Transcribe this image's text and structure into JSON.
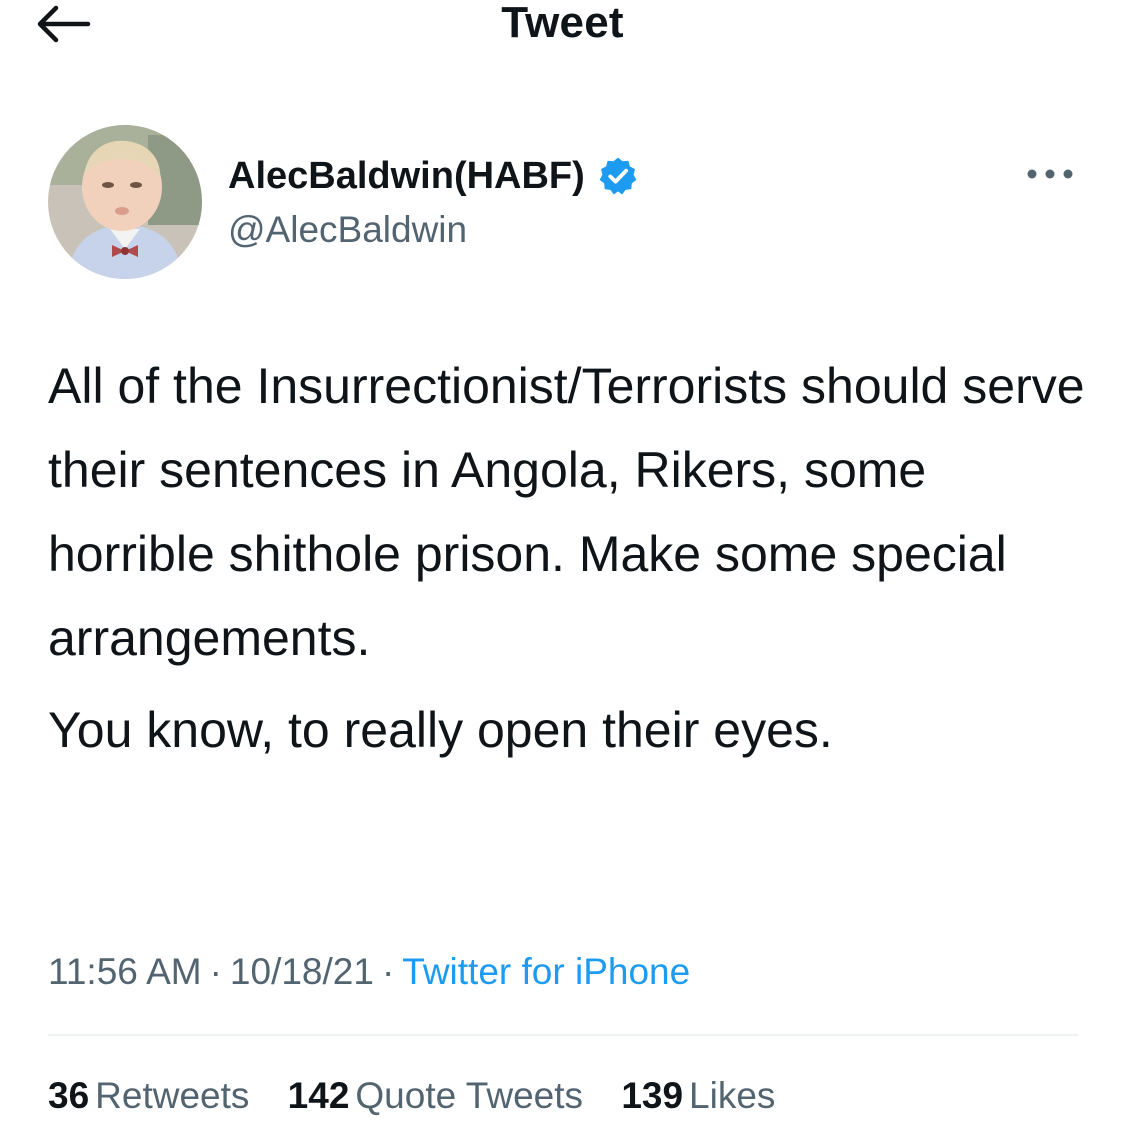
{
  "header": {
    "title": "Tweet",
    "back_icon": "arrow-left-icon"
  },
  "author": {
    "display_name": "AlecBaldwin(HABF)",
    "handle": "@AlecBaldwin",
    "verified_icon": "verified-badge-icon",
    "more_icon": "more-horizontal-icon"
  },
  "tweet": {
    "paragraphs": [
      "All of the Insurrectionist/Terrorists should serve their sentences in Angola, Rikers, some horrible shithole prison. Make some special arrangements.",
      "You know, to really open their eyes."
    ],
    "time": "11:56 AM",
    "separator": "·",
    "date": "10/18/21",
    "source": "Twitter for iPhone"
  },
  "stats": {
    "retweets_count": "36",
    "retweets_label": "Retweets",
    "quotes_count": "142",
    "quotes_label": "Quote Tweets",
    "likes_count": "139",
    "likes_label": "Likes"
  },
  "colors": {
    "text": "#0f1419",
    "secondary": "#536471",
    "accent": "#1d9bf0",
    "divider": "#eff3f4"
  }
}
